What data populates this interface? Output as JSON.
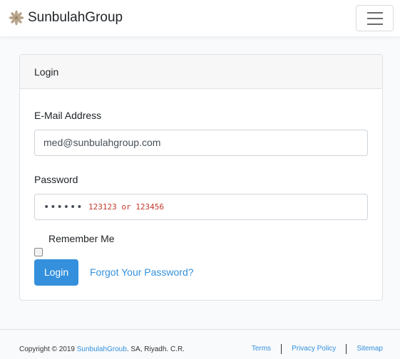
{
  "navbar": {
    "brand": "SunbulahGroup",
    "logo_icon": "sunburst-flower-icon",
    "menu_icon": "hamburger-menu-icon"
  },
  "login_card": {
    "header": "Login",
    "email_label": "E-Mail Address",
    "email_value": "med@sunbulahgroup.com",
    "password_label": "Password",
    "password_value": "••••••",
    "password_hint": "123123 or 123456",
    "remember_label": "Remember Me",
    "remember_checked": false,
    "login_button": "Login",
    "forgot_link": "Forgot Your Password?"
  },
  "footer": {
    "copyright_prefix": "Copyright © 2019 ",
    "company_link": "SunbulahGroub",
    "copyright_suffix": ". SA, Riyadh. C.R.",
    "links": [
      "Terms",
      "Privacy Policy",
      "Sitemap"
    ]
  },
  "colors": {
    "accent": "#3490dc",
    "hint": "#c0392b",
    "background": "#f8fafc"
  }
}
